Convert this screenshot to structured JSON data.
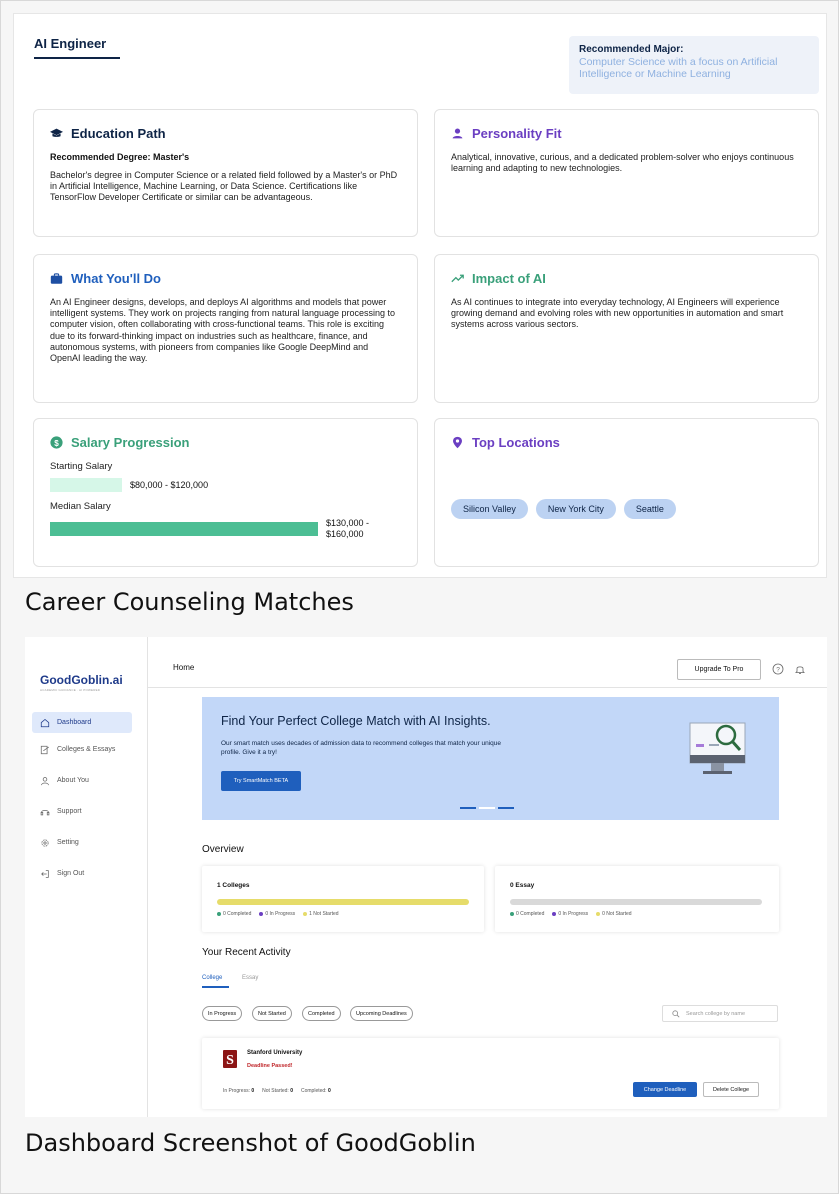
{
  "career": {
    "title": "AI Engineer",
    "recommended_major_label": "Recommended Major:",
    "recommended_major": "Computer Science with a focus on Artificial Intelligence or Machine Learning",
    "education": {
      "heading": "Education Path",
      "degree": "Recommended Degree: Master's",
      "text": "Bachelor's degree in Computer Science or a related field followed by a Master's or PhD in Artificial Intelligence, Machine Learning, or Data Science. Certifications like TensorFlow Developer Certificate or similar can be advantageous."
    },
    "personality": {
      "heading": "Personality Fit",
      "text": "Analytical, innovative, curious, and a dedicated problem-solver who enjoys continuous learning and adapting to new technologies."
    },
    "what_you_do": {
      "heading": "What You'll Do",
      "text": "An AI Engineer designs, develops, and deploys AI algorithms and models that power intelligent systems. They work on projects ranging from natural language processing to computer vision, often collaborating with cross-functional teams. This role is exciting due to its forward-thinking impact on industries such as healthcare, finance, and autonomous systems, with pioneers from companies like Google DeepMind and OpenAI leading the way."
    },
    "impact": {
      "heading": "Impact of AI",
      "text": "As AI continues to integrate into everyday technology, AI Engineers will experience growing demand and evolving roles with new opportunities in automation and smart systems across various sectors."
    },
    "salary": {
      "heading": "Salary Progression",
      "starting_label": "Starting Salary",
      "starting_value": "$80,000 - $120,000",
      "median_label": "Median Salary",
      "median_value_line1": "$130,000 -",
      "median_value_line2": "$160,000"
    },
    "locations": {
      "heading": "Top Locations",
      "items": [
        "Silicon Valley",
        "New York City",
        "Seattle"
      ]
    }
  },
  "captions": {
    "first": "Career Counseling Matches",
    "second": "Dashboard Screenshot of GoodGoblin"
  },
  "dashboard": {
    "logo": "GoodGoblin.ai",
    "logo_tagline": "ACADEMIC GUIDANCE · AI POWERED",
    "sidebar": [
      {
        "label": "Dashboard"
      },
      {
        "label": "Colleges & Essays"
      },
      {
        "label": "About You"
      },
      {
        "label": "Support"
      },
      {
        "label": "Setting"
      },
      {
        "label": "Sign Out"
      }
    ],
    "header": {
      "page": "Home",
      "upgrade": "Upgrade To Pro"
    },
    "hero": {
      "title": "Find Your Perfect College Match with AI Insights.",
      "text": "Our smart match uses decades of admission data to recommend colleges that match your unique profile. Give it a try!",
      "button": "Try SmartMatch BETA"
    },
    "overview": {
      "title": "Overview",
      "colleges": {
        "title": "1 Colleges",
        "completed": "0 Completed",
        "in_progress": "0 In Progress",
        "not_started": "1 Not Started"
      },
      "essays": {
        "title": "0 Essay",
        "completed": "0 Completed",
        "in_progress": "0 In Progress",
        "not_started": "0 Not Started"
      }
    },
    "recent": {
      "title": "Your Recent Activity",
      "tabs": [
        "College",
        "Essay"
      ],
      "filters": [
        "In Progress",
        "Not Started",
        "Completed",
        "Upcoming Deadlines"
      ],
      "search_placeholder": "Search college by name",
      "college": {
        "name": "Stanford University",
        "status": "Deadline Passed!",
        "in_progress_label": "In Progress:",
        "in_progress": "0",
        "not_started_label": "Not Started:",
        "not_started": "0",
        "completed_label": "Completed:",
        "completed": "0",
        "change_button": "Change Deadline",
        "delete_button": "Delete College"
      }
    }
  },
  "colors": {
    "navy": "#0e2446",
    "accent_blue": "#1f5fbd",
    "purple": "#6b3fc2",
    "green": "#3aa07a",
    "hero_bg": "#c2d7f8",
    "deadline_red": "#c0262a"
  }
}
